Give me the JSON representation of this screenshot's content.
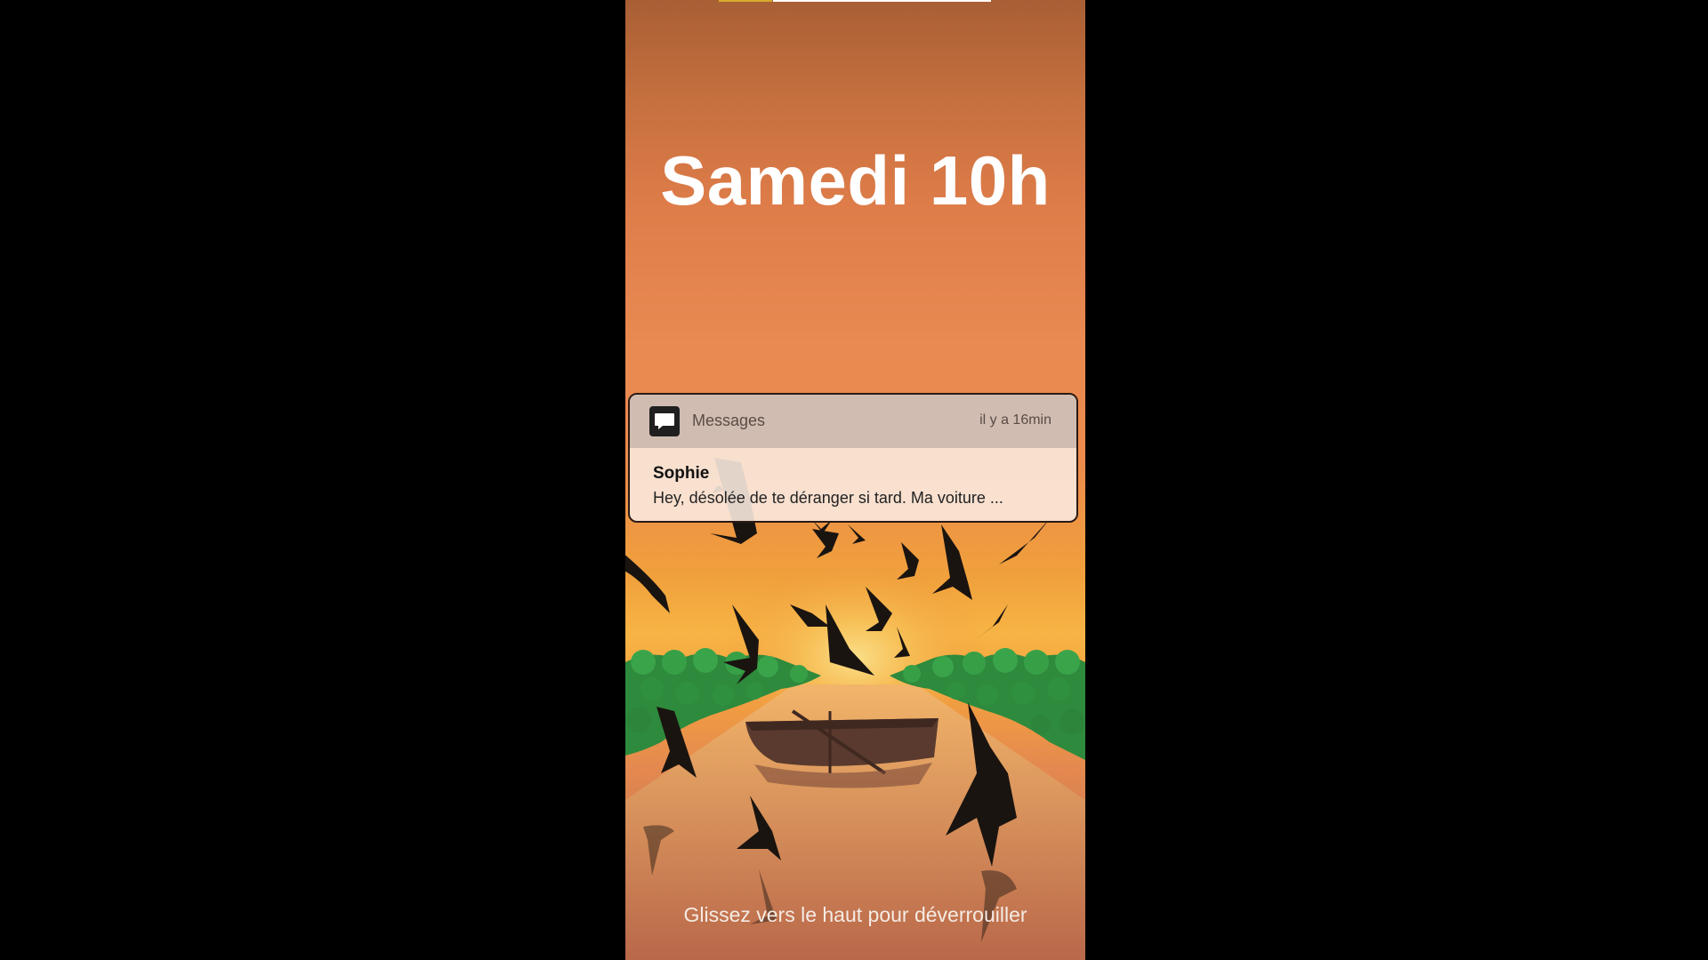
{
  "lock_screen": {
    "datetime": "Samedi 10h",
    "unlock_hint": "Glissez vers le haut pour déverrouiller"
  },
  "notification": {
    "app_icon": "message-bubble-icon",
    "app_name": "Messages",
    "time": "il y a 16min",
    "sender": "Sophie",
    "preview": "Hey, désolée de te déranger si tard. Ma voiture ..."
  },
  "wallpaper": {
    "description_icon": "sunset-river-birds-wallpaper",
    "sky_top": "#a85f35",
    "sun": "#f7b444",
    "bird": "#1a1410",
    "foliage": "#2e8a3c"
  }
}
